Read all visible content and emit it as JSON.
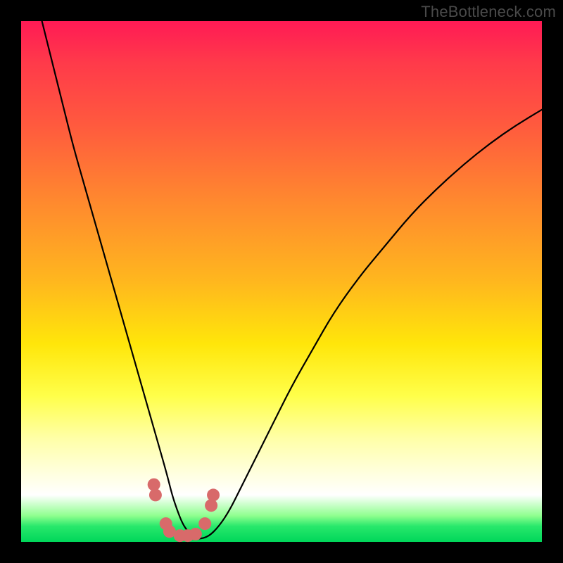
{
  "watermark": "TheBottleneck.com",
  "chart_data": {
    "type": "line",
    "title": "",
    "xlabel": "",
    "ylabel": "",
    "xlim": [
      0,
      100
    ],
    "ylim": [
      0,
      100
    ],
    "grid": false,
    "series": [
      {
        "name": "curve",
        "x": [
          4,
          6,
          8,
          10,
          12,
          14,
          16,
          18,
          20,
          22,
          24,
          26,
          28,
          29,
          30,
          31,
          32,
          33,
          34,
          36,
          38,
          40,
          42,
          45,
          48,
          52,
          56,
          60,
          65,
          70,
          75,
          80,
          85,
          90,
          95,
          100
        ],
        "values": [
          100,
          92,
          84,
          76,
          69,
          62,
          55,
          48,
          41,
          34,
          27,
          20,
          13,
          9,
          6,
          3.5,
          2,
          1,
          0.5,
          1,
          3,
          6,
          10,
          16,
          22,
          30,
          37,
          44,
          51,
          57,
          63,
          68,
          72.5,
          76.5,
          80,
          83
        ]
      }
    ],
    "markers": [
      {
        "x": 25.5,
        "y": 11
      },
      {
        "x": 25.8,
        "y": 9
      },
      {
        "x": 27.8,
        "y": 3.5
      },
      {
        "x": 28.5,
        "y": 2
      },
      {
        "x": 30.5,
        "y": 1.2
      },
      {
        "x": 32.0,
        "y": 1.2
      },
      {
        "x": 33.5,
        "y": 1.5
      },
      {
        "x": 35.3,
        "y": 3.5
      },
      {
        "x": 36.5,
        "y": 7
      },
      {
        "x": 36.9,
        "y": 9
      }
    ],
    "marker_color": "#d86a6a",
    "curve_color": "#000000"
  }
}
